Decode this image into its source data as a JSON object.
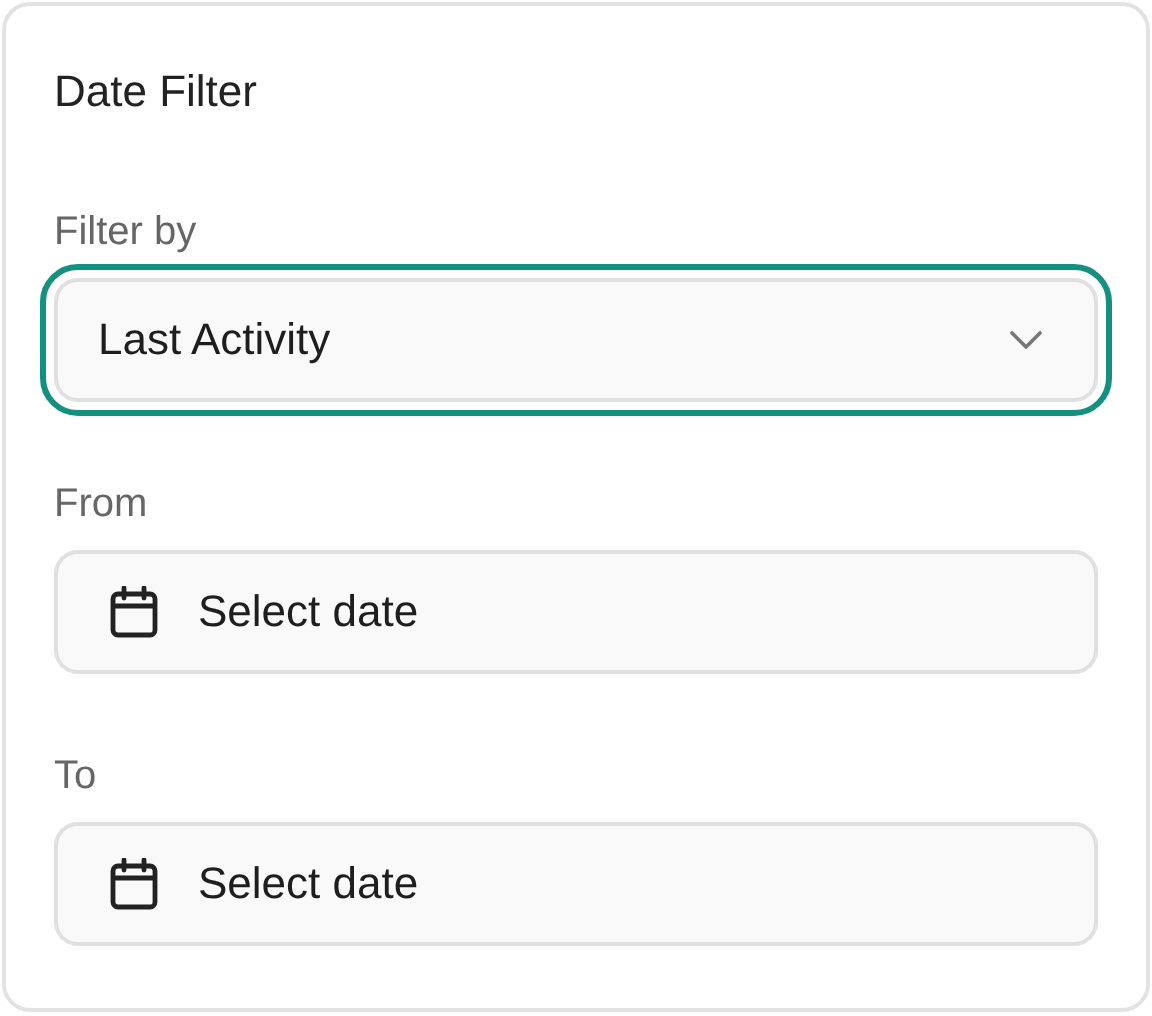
{
  "panel": {
    "title": "Date Filter"
  },
  "fields": [
    {
      "kind": "select",
      "label": "Filter by",
      "value": "Last Activity",
      "focused": true
    },
    {
      "kind": "date",
      "label": "From",
      "text": "Select date",
      "focused": false
    },
    {
      "kind": "date",
      "label": "To",
      "text": "Select date",
      "focused": false
    }
  ]
}
